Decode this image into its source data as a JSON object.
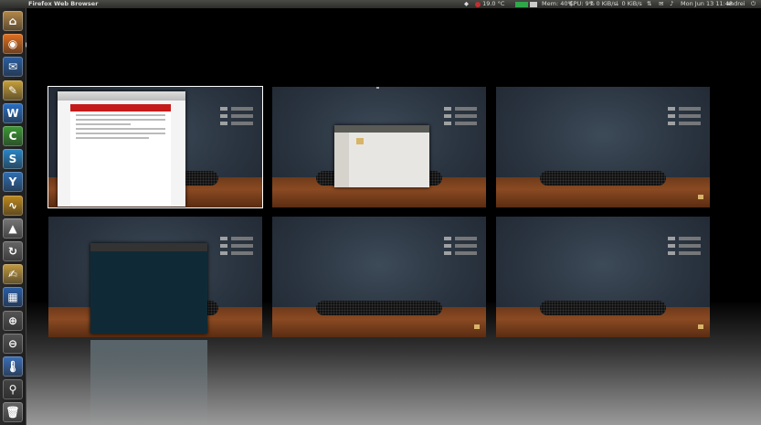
{
  "top_panel": {
    "app_title": "Firefox Web Browser",
    "weather": "19.0 °C",
    "memory": "Mem: 40%",
    "cpu": "CPU: 9%",
    "net_up": "↑ 0 KiB/s",
    "net_down": "↓ 0 KiB/s",
    "clock": "Mon Jun 13 11:48",
    "user": "andrei"
  },
  "launcher": {
    "items": [
      {
        "name": "home-folder-icon",
        "glyph": "⌂",
        "color": "#b5894a"
      },
      {
        "name": "firefox-icon",
        "glyph": "◉",
        "color": "#e2701e"
      },
      {
        "name": "thunderbird-icon",
        "glyph": "✉",
        "color": "#2b5fa3"
      },
      {
        "name": "text-editor-icon",
        "glyph": "✎",
        "color": "#c9a03a"
      },
      {
        "name": "writer-icon",
        "glyph": "W",
        "color": "#2a6fc4"
      },
      {
        "name": "calc-icon",
        "glyph": "C",
        "color": "#3c9a36"
      },
      {
        "name": "skype-icon",
        "glyph": "S",
        "color": "#2a86c8"
      },
      {
        "name": "y-ppa-manager-icon",
        "glyph": "Y",
        "color": "#2f6fb5"
      },
      {
        "name": "system-monitor-icon",
        "glyph": "∿",
        "color": "#c08a1e"
      },
      {
        "name": "update-manager-icon",
        "glyph": "▲",
        "color": "#777"
      },
      {
        "name": "refresh-icon",
        "glyph": "↻",
        "color": "#666"
      },
      {
        "name": "notes-icon",
        "glyph": "✍",
        "color": "#c29a40"
      },
      {
        "name": "workspace-switcher-icon",
        "glyph": "▦",
        "color": "#2a5fa8"
      },
      {
        "name": "zoom-in-icon",
        "glyph": "⊕",
        "color": "#555"
      },
      {
        "name": "zoom-out-icon",
        "glyph": "⊖",
        "color": "#555"
      },
      {
        "name": "thermometer-icon",
        "glyph": "🌡",
        "color": "#3a6fb8"
      },
      {
        "name": "search-icon",
        "glyph": "⚲",
        "color": "#444"
      },
      {
        "name": "trash-icon",
        "glyph": "🗑",
        "color": "#666"
      }
    ]
  }
}
